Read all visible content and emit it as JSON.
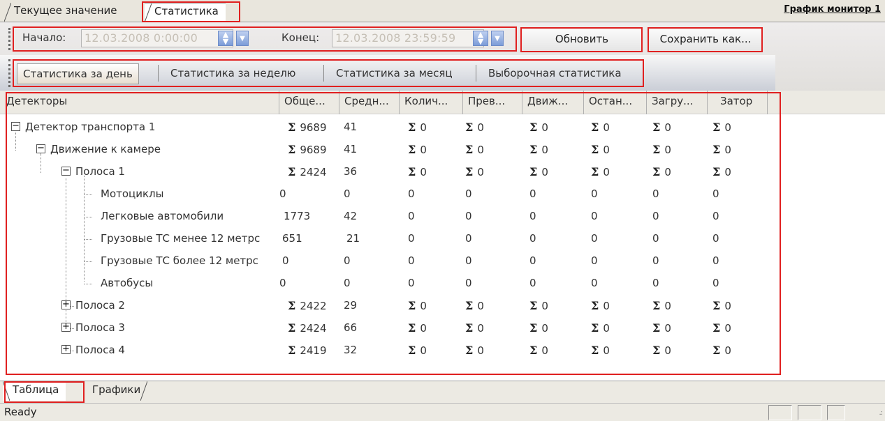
{
  "tabs": {
    "current_value": "Текущее значение",
    "statistics": "Статистика"
  },
  "brand": "График монитор 1",
  "toolbar": {
    "start_label": "Начало:",
    "start_value": "12.03.2008 0:00:00",
    "end_label": "Конец:",
    "end_value": "12.03.2008 23:59:59",
    "refresh_label": "Обновить",
    "save_as_label": "Сохранить как..."
  },
  "period_tabs": [
    "Статистика за день",
    "Статистика за неделю",
    "Статистика за месяц",
    "Выборочная статистика"
  ],
  "grid": {
    "columns": [
      "Детекторы",
      "Обще...",
      "Средн...",
      "Колич...",
      "Прев...",
      "Движ...",
      "Остан...",
      "Загру...",
      "Затор"
    ],
    "rows": [
      {
        "name": "Детектор транспорта 1",
        "total": "9689",
        "avg": "41",
        "rest": [
          "0",
          "0",
          "0",
          "0",
          "0",
          "0"
        ]
      },
      {
        "name": "Движение к камере",
        "total": "9689",
        "avg": "41",
        "rest": [
          "0",
          "0",
          "0",
          "0",
          "0",
          "0"
        ]
      },
      {
        "name": "Полоса 1",
        "total": "2424",
        "avg": "36",
        "rest": [
          "0",
          "0",
          "0",
          "0",
          "0",
          "0"
        ]
      },
      {
        "name": "Мотоциклы",
        "total": "0",
        "avg": "0",
        "rest": [
          "0",
          "0",
          "0",
          "0",
          "0",
          "0"
        ]
      },
      {
        "name": "Легковые автомобили",
        "total": "1773",
        "avg": "42",
        "rest": [
          "0",
          "0",
          "0",
          "0",
          "0",
          "0"
        ]
      },
      {
        "name": "Грузовые ТС менее 12 метрс",
        "total": "651",
        "avg": "21",
        "rest": [
          "0",
          "0",
          "0",
          "0",
          "0",
          "0"
        ]
      },
      {
        "name": "Грузовые ТС более 12 метрс",
        "total": "0",
        "avg": "0",
        "rest": [
          "0",
          "0",
          "0",
          "0",
          "0",
          "0"
        ]
      },
      {
        "name": "Автобусы",
        "total": "0",
        "avg": "0",
        "rest": [
          "0",
          "0",
          "0",
          "0",
          "0",
          "0"
        ]
      },
      {
        "name": "Полоса 2",
        "total": "2422",
        "avg": "29",
        "rest": [
          "0",
          "0",
          "0",
          "0",
          "0",
          "0"
        ]
      },
      {
        "name": "Полоса 3",
        "total": "2424",
        "avg": "66",
        "rest": [
          "0",
          "0",
          "0",
          "0",
          "0",
          "0"
        ]
      },
      {
        "name": "Полоса 4",
        "total": "2419",
        "avg": "32",
        "rest": [
          "0",
          "0",
          "0",
          "0",
          "0",
          "0"
        ]
      }
    ],
    "sigma": "Σ"
  },
  "bottom_tabs": {
    "table": "Таблица",
    "graphs": "Графики"
  },
  "status": "Ready",
  "colors": {
    "highlight": "#e02020",
    "spin_button": "#7c9cd8"
  }
}
